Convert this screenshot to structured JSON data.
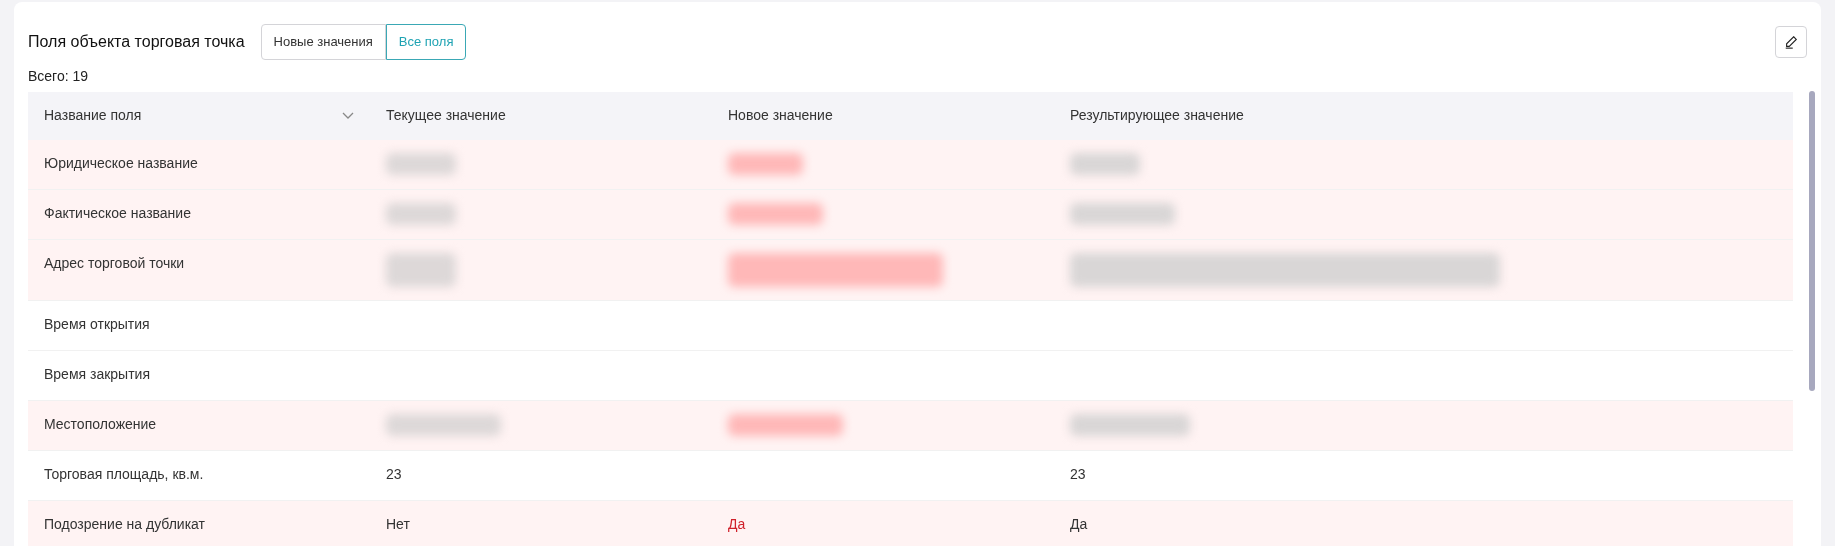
{
  "panel": {
    "title": "Поля объекта торговая точка",
    "total": "Всего: 19"
  },
  "filters": [
    {
      "label": "Новые значения",
      "selected": false
    },
    {
      "label": "Все поля",
      "selected": true
    }
  ],
  "table": {
    "columns": [
      "Название поля",
      "Текущее значение",
      "Новое значение",
      "Результирующее значение"
    ],
    "rows": [
      {
        "field": "Юридическое название",
        "changed": true,
        "current": {
          "kind": "blurred"
        },
        "new": {
          "kind": "blurred"
        },
        "result": {
          "kind": "blurred"
        }
      },
      {
        "field": "Фактическое название",
        "changed": true,
        "current": {
          "kind": "blurred"
        },
        "new": {
          "kind": "blurred"
        },
        "result": {
          "kind": "blurred"
        }
      },
      {
        "field": "Адрес торговой точки",
        "changed": true,
        "current": {
          "kind": "blurred"
        },
        "new": {
          "kind": "blurred"
        },
        "result": {
          "kind": "blurred"
        }
      },
      {
        "field": "Время открытия",
        "changed": false
      },
      {
        "field": "Время закрытия",
        "changed": false
      },
      {
        "field": "Местоположение",
        "changed": true,
        "current": {
          "kind": "blurred"
        },
        "new": {
          "kind": "blurred"
        },
        "result": {
          "kind": "blurred"
        }
      },
      {
        "field": "Торговая площадь, кв.м.",
        "changed": false,
        "current": {
          "kind": "text",
          "text": "23"
        },
        "result": {
          "kind": "text",
          "text": "23"
        }
      },
      {
        "field": "Подозрение на дубликат",
        "changed": true,
        "current": {
          "kind": "text",
          "text": "Нет"
        },
        "new": {
          "kind": "text",
          "text": "Да"
        },
        "result": {
          "kind": "text",
          "text": "Да"
        }
      }
    ]
  }
}
